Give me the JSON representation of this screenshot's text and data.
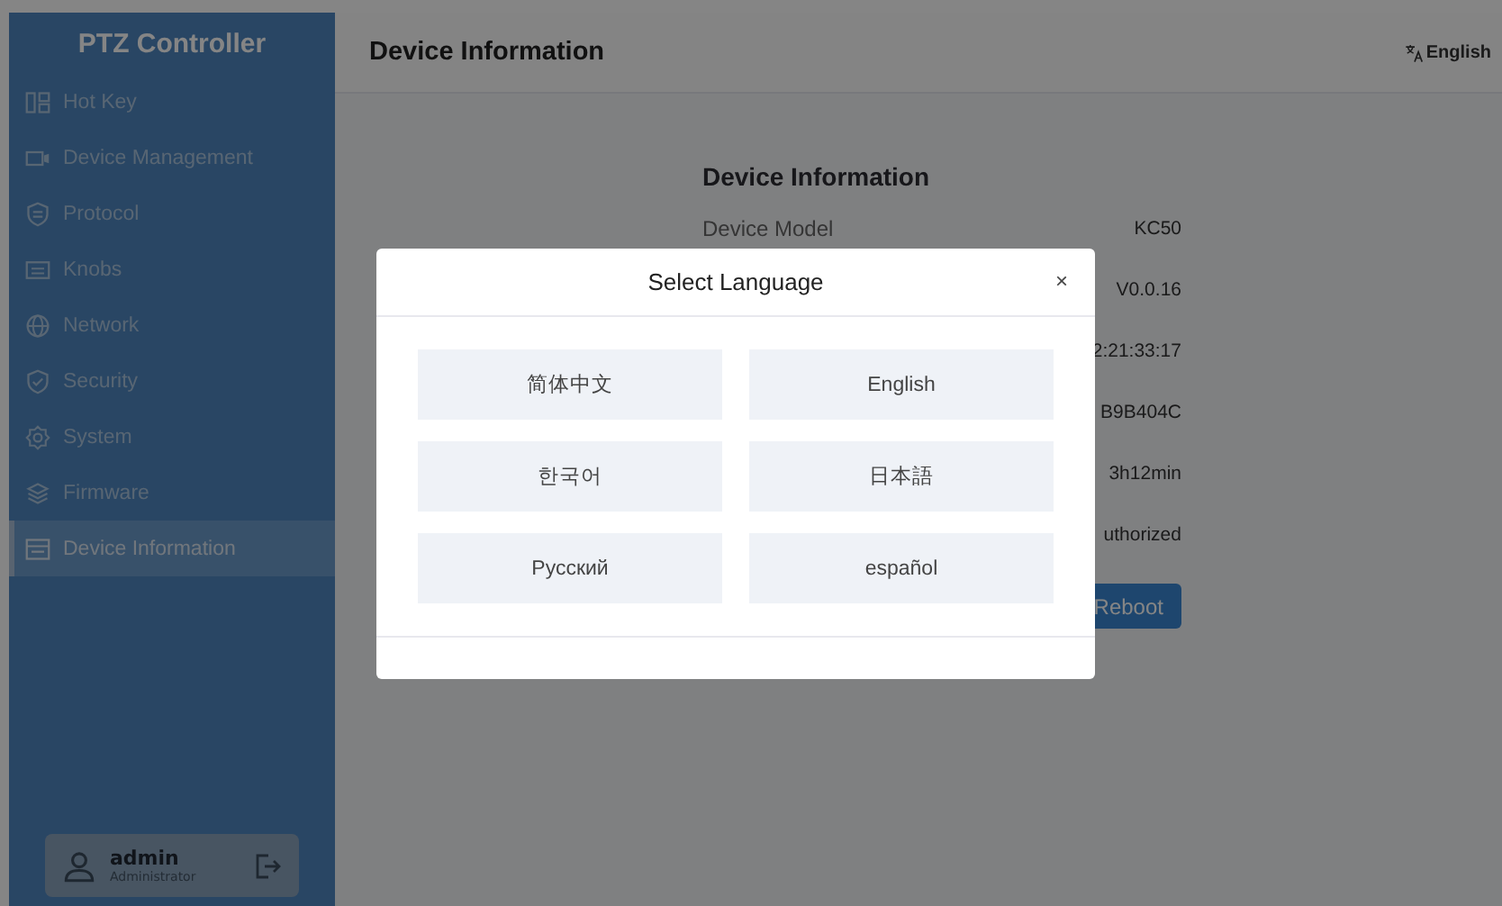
{
  "sidebar": {
    "title": "PTZ Controller",
    "items": [
      {
        "label": "Hot Key",
        "selected": false
      },
      {
        "label": "Device Management",
        "selected": false
      },
      {
        "label": "Protocol",
        "selected": false
      },
      {
        "label": "Knobs",
        "selected": false
      },
      {
        "label": "Network",
        "selected": false
      },
      {
        "label": "Security",
        "selected": false
      },
      {
        "label": "System",
        "selected": false
      },
      {
        "label": "Firmware",
        "selected": false
      },
      {
        "label": "Device Information",
        "selected": true
      }
    ],
    "user": {
      "name": "admin",
      "role": "Administrator"
    }
  },
  "header": {
    "title": "Device Information",
    "language": "English"
  },
  "info": {
    "title": "Device Information",
    "rows": [
      {
        "label": "Device Model",
        "value": "KC50"
      },
      {
        "value": "V0.0.16"
      },
      {
        "value": "2:21:33:17"
      },
      {
        "value": "B9B404C"
      },
      {
        "value": "3h12min"
      },
      {
        "value": "uthorized"
      }
    ],
    "button": "Reboot"
  },
  "dialog": {
    "title": "Select Language",
    "close": "×",
    "options": [
      {
        "label": "简体中文"
      },
      {
        "label": "English"
      },
      {
        "label": "한국어"
      },
      {
        "label": "日本語"
      },
      {
        "label": "Русский"
      },
      {
        "label": "español"
      }
    ]
  }
}
